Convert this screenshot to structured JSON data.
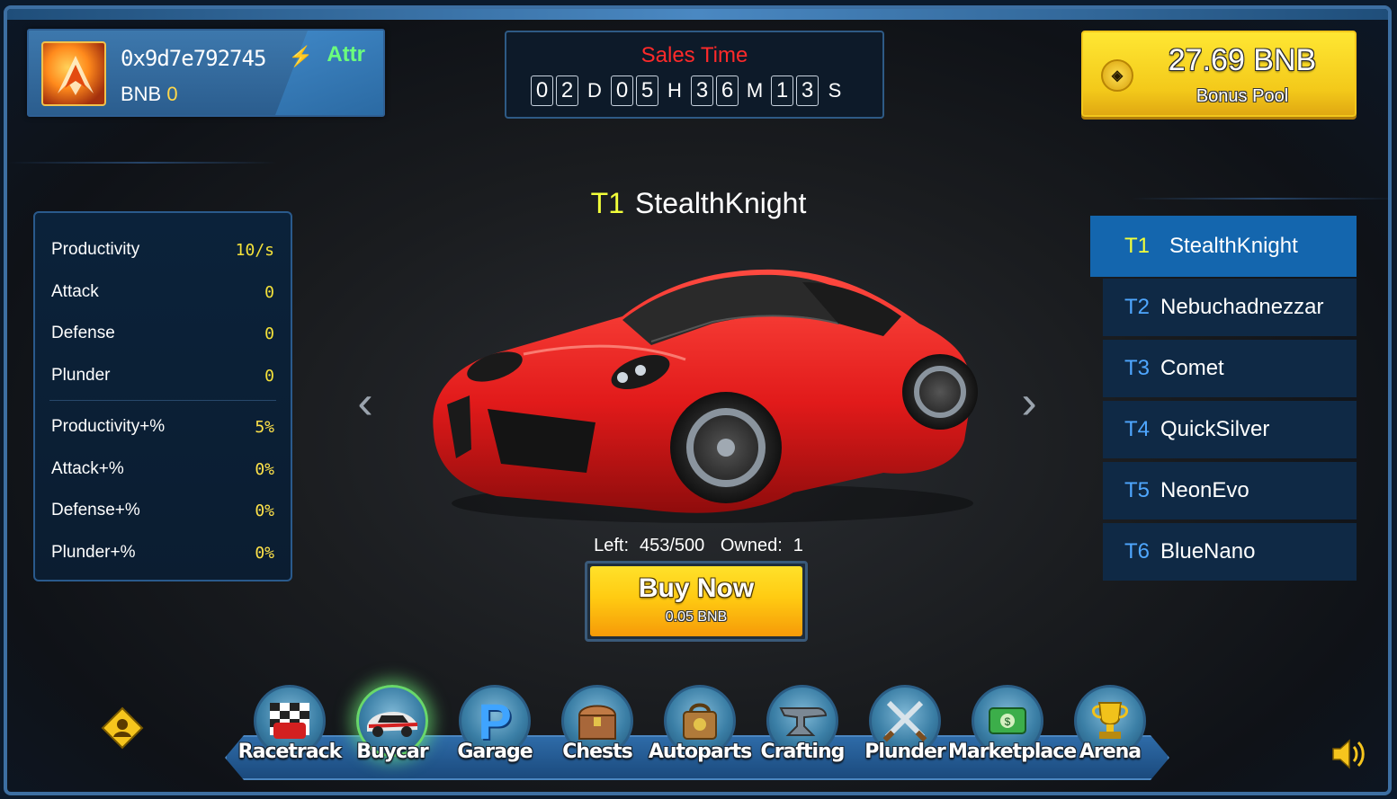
{
  "profile": {
    "address": "0x9d7e792745",
    "attr_label": "Attr",
    "currency_label": "BNB",
    "balance": "0"
  },
  "sales": {
    "title": "Sales Time",
    "days": [
      "0",
      "2"
    ],
    "days_unit": "D",
    "hours": [
      "0",
      "5"
    ],
    "hours_unit": "H",
    "minutes": [
      "3",
      "6"
    ],
    "minutes_unit": "M",
    "seconds": [
      "1",
      "3"
    ],
    "seconds_unit": "S"
  },
  "pool": {
    "value": "27.69 BNB",
    "label": "Bonus Pool"
  },
  "stats": [
    {
      "label": "Productivity",
      "value": "10/s"
    },
    {
      "label": "Attack",
      "value": "0"
    },
    {
      "label": "Defense",
      "value": "0"
    },
    {
      "label": "Plunder",
      "value": "0"
    },
    {
      "label": "Productivity+%",
      "value": "5%"
    },
    {
      "label": "Attack+%",
      "value": "0%"
    },
    {
      "label": "Defense+%",
      "value": "0%"
    },
    {
      "label": "Plunder+%",
      "value": "0%"
    }
  ],
  "car": {
    "tier": "T1",
    "name": "StealthKnight",
    "left_label": "Left:",
    "left_value": "453/500",
    "owned_label": "Owned:",
    "owned_value": "1",
    "color": "#e11a1a"
  },
  "buy": {
    "label": "Buy Now",
    "price": "0.05 BNB"
  },
  "tiers": [
    {
      "tier": "T1",
      "name": "StealthKnight"
    },
    {
      "tier": "T2",
      "name": "Nebuchadnezzar"
    },
    {
      "tier": "T3",
      "name": "Comet"
    },
    {
      "tier": "T4",
      "name": "QuickSilver"
    },
    {
      "tier": "T5",
      "name": "NeonEvo"
    },
    {
      "tier": "T6",
      "name": "BlueNano"
    }
  ],
  "nav": [
    {
      "label": "Racetrack",
      "icon": "racetrack-icon"
    },
    {
      "label": "Buycar",
      "icon": "buycar-icon"
    },
    {
      "label": "Garage",
      "icon": "garage-icon"
    },
    {
      "label": "Chests",
      "icon": "chest-icon"
    },
    {
      "label": "Autoparts",
      "icon": "autoparts-icon"
    },
    {
      "label": "Crafting",
      "icon": "anvil-icon"
    },
    {
      "label": "Plunder",
      "icon": "crossed-swords-icon"
    },
    {
      "label": "Marketplace",
      "icon": "money-icon"
    },
    {
      "label": "Arena",
      "icon": "trophy-icon"
    }
  ],
  "colors": {
    "accent": "#1466ae",
    "highlight": "#f3ff3a",
    "timer_title": "#ff2a2a",
    "gold": "#ffcb12"
  }
}
